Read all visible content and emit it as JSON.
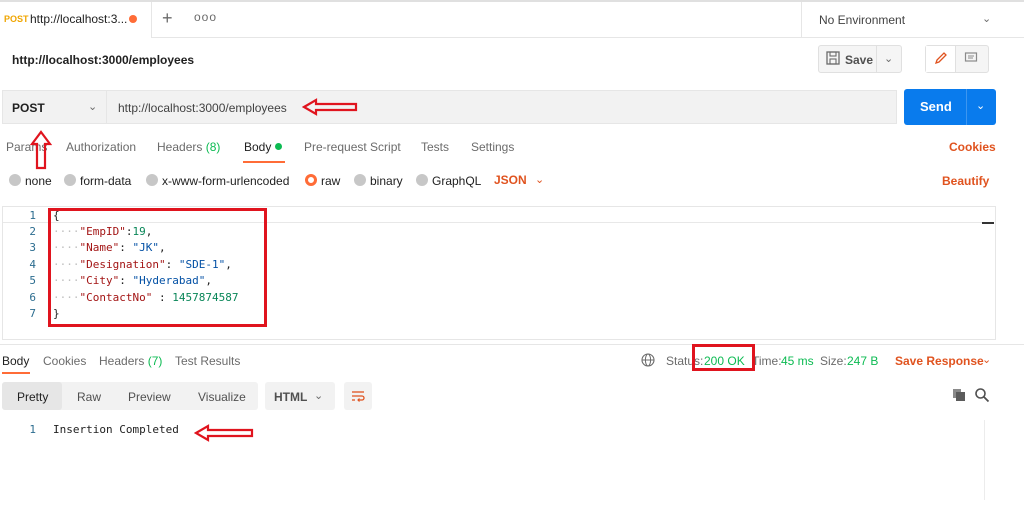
{
  "tabbar": {
    "tab": {
      "method": "POST",
      "title": "http://localhost:3..."
    },
    "more_label": "ooo",
    "environment": "No Environment"
  },
  "request": {
    "name": "http://localhost:3000/employees",
    "save_label": "Save",
    "method": "POST",
    "url": "http://localhost:3000/employees",
    "send_label": "Send",
    "tabs": [
      {
        "label": "Params"
      },
      {
        "label": "Authorization"
      },
      {
        "label": "Headers",
        "count": "(8)"
      },
      {
        "label": "Body"
      },
      {
        "label": "Pre-request Script"
      },
      {
        "label": "Tests"
      },
      {
        "label": "Settings"
      }
    ],
    "cookies_label": "Cookies",
    "body_types": [
      "none",
      "form-data",
      "x-www-form-urlencoded",
      "raw",
      "binary",
      "GraphQL"
    ],
    "selected_body_type": "raw",
    "language": "JSON",
    "beautify_label": "Beautify",
    "code_lines": [
      {
        "num": "1",
        "text": "{"
      },
      {
        "num": "2",
        "key": "\"EmpID\"",
        "sep": ":",
        "value": "19",
        "tail": ",",
        "vtype": "num"
      },
      {
        "num": "3",
        "key": "\"Name\"",
        "sep": ": ",
        "value": "\"JK\"",
        "tail": ",",
        "vtype": "str"
      },
      {
        "num": "4",
        "key": "\"Designation\"",
        "sep": ": ",
        "value": "\"SDE-1\"",
        "tail": ",",
        "vtype": "str"
      },
      {
        "num": "5",
        "key": "\"City\"",
        "sep": ": ",
        "value": "\"Hyderabad\"",
        "tail": ",",
        "vtype": "str"
      },
      {
        "num": "6",
        "key": "\"ContactNo\"",
        "sep": " : ",
        "value": "1457874587",
        "tail": "",
        "vtype": "num"
      },
      {
        "num": "7",
        "text": "}"
      }
    ]
  },
  "response": {
    "tabs": [
      {
        "label": "Body"
      },
      {
        "label": "Cookies"
      },
      {
        "label": "Headers",
        "count": "(7)"
      },
      {
        "label": "Test Results"
      }
    ],
    "status_label": "Status:",
    "status_value": "200 OK",
    "time_label": "Time:",
    "time_value": "45 ms",
    "size_label": "Size:",
    "size_value": "247 B",
    "save_response_label": "Save Response",
    "views": [
      "Pretty",
      "Raw",
      "Preview",
      "Visualize"
    ],
    "format": "HTML",
    "line_num": "1",
    "body_text": "Insertion Completed"
  },
  "colors": {
    "accent": "#ff6c37",
    "send_blue": "#097bed",
    "link_orange": "#e0531f",
    "success_green": "#0cbb52",
    "annotation_red": "#e0141e"
  }
}
